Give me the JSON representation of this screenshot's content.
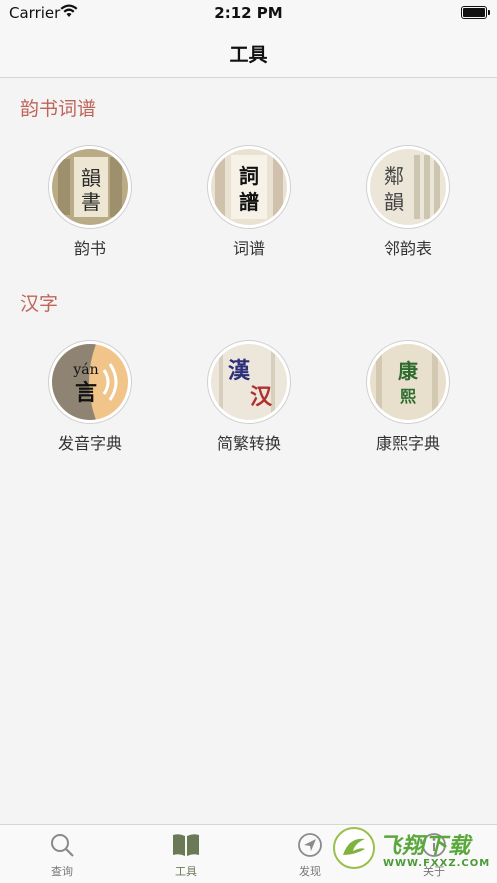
{
  "status_bar": {
    "carrier": "Carrier",
    "time": "2:12 PM"
  },
  "nav": {
    "title": "工具"
  },
  "sections": [
    {
      "title": "韵书词谱",
      "tools": [
        {
          "label": "韵书",
          "glyphs": [
            "韻",
            "書"
          ],
          "icon": "rhyme-book-icon"
        },
        {
          "label": "词谱",
          "glyphs": [
            "詞",
            "譜"
          ],
          "icon": "ci-pu-icon"
        },
        {
          "label": "邻韵表",
          "glyphs": [
            "鄰",
            "韻"
          ],
          "icon": "neighbor-rhyme-icon"
        }
      ]
    },
    {
      "title": "汉字",
      "tools": [
        {
          "label": "发音字典",
          "glyphs": [
            "yán",
            "言"
          ],
          "icon": "pronunciation-icon"
        },
        {
          "label": "简繁转换",
          "glyphs": [
            "漢",
            "汉"
          ],
          "icon": "convert-icon"
        },
        {
          "label": "康熙字典",
          "glyphs": [
            "康",
            "熙"
          ],
          "icon": "kangxi-icon"
        }
      ]
    }
  ],
  "tabs": [
    {
      "label": "查询",
      "icon": "search-icon",
      "active": false
    },
    {
      "label": "工具",
      "icon": "book-icon",
      "active": true
    },
    {
      "label": "发现",
      "icon": "compass-icon",
      "active": false
    },
    {
      "label": "关于",
      "icon": "info-icon",
      "active": false
    }
  ],
  "watermark": {
    "brand": "飞翔下载",
    "url": "WWW.FXXZ.COM"
  },
  "colors": {
    "section_title": "#c0645a",
    "tab_active": "#6b7a56",
    "background": "#f4f4f4"
  }
}
